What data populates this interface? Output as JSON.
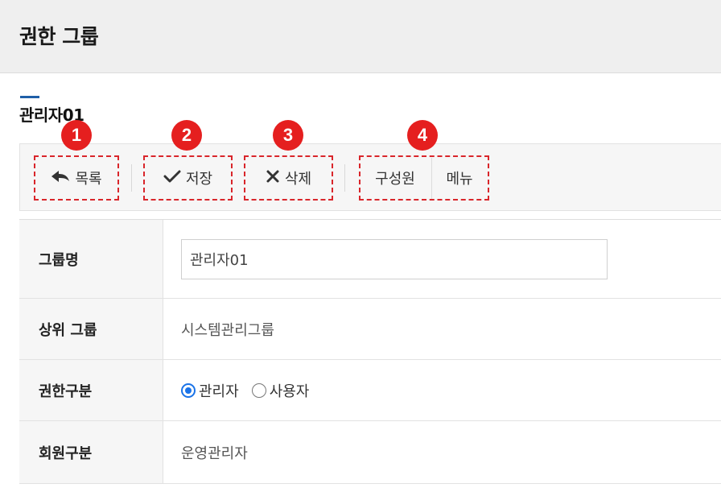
{
  "header": {
    "title": "권한 그룹"
  },
  "section": {
    "title": "관리자01"
  },
  "toolbar": {
    "list_label": "목록",
    "save_label": "저장",
    "delete_label": "삭제",
    "members_label": "구성원",
    "menu_label": "메뉴"
  },
  "callouts": [
    "1",
    "2",
    "3",
    "4"
  ],
  "form": {
    "group_name": {
      "label": "그룹명",
      "value": "관리자01"
    },
    "parent_group": {
      "label": "상위 그룹",
      "value": "시스템관리그룹"
    },
    "auth_type": {
      "label": "권한구분",
      "options": [
        "관리자",
        "사용자"
      ],
      "selected": "관리자"
    },
    "member_type": {
      "label": "회원구분",
      "value": "운영관리자"
    }
  },
  "colors": {
    "accent": "#1f5fa8",
    "callout": "#e51f1f",
    "radio": "#1a73e8"
  }
}
